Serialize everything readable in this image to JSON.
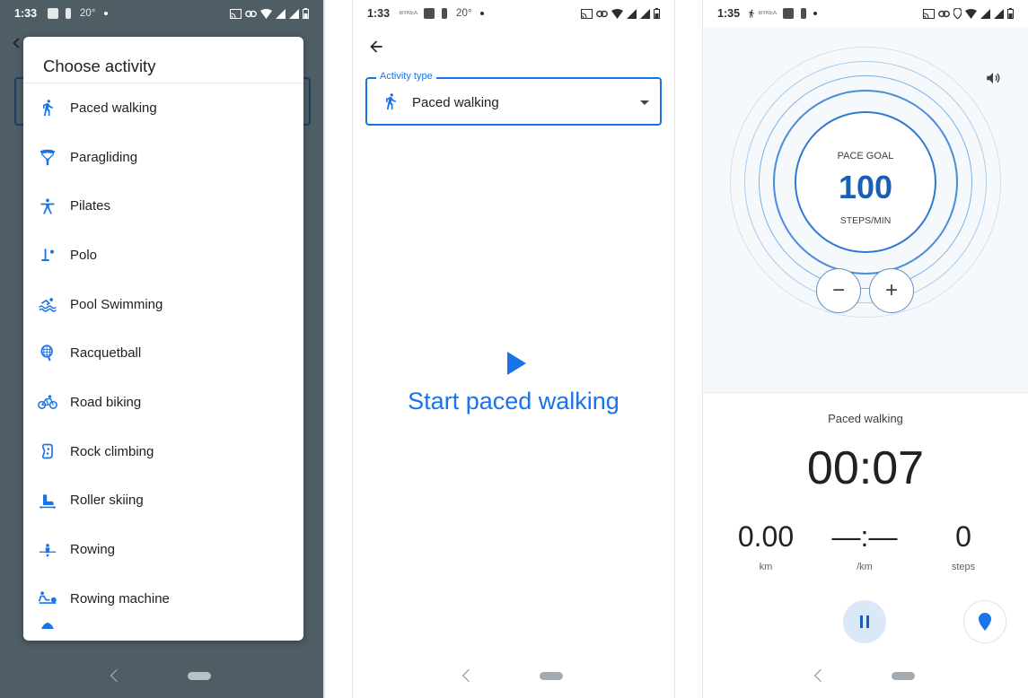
{
  "screen1": {
    "status": {
      "time": "1:33",
      "temp": "20°",
      "tiny": "BYKEA"
    },
    "dialog": {
      "title": "Choose activity",
      "items": [
        {
          "label": "Paced walking",
          "icon": "walking-icon"
        },
        {
          "label": "Paragliding",
          "icon": "paragliding-icon"
        },
        {
          "label": "Pilates",
          "icon": "pilates-icon"
        },
        {
          "label": "Polo",
          "icon": "polo-icon"
        },
        {
          "label": "Pool Swimming",
          "icon": "swimming-icon"
        },
        {
          "label": "Racquetball",
          "icon": "racquet-icon"
        },
        {
          "label": "Road biking",
          "icon": "bike-icon"
        },
        {
          "label": "Rock climbing",
          "icon": "climbing-icon"
        },
        {
          "label": "Roller skiing",
          "icon": "skate-icon"
        },
        {
          "label": "Rowing",
          "icon": "rowing-icon"
        },
        {
          "label": "Rowing machine",
          "icon": "rowing-machine-icon"
        }
      ]
    }
  },
  "screen2": {
    "status": {
      "time": "1:33",
      "temp": "20°",
      "tiny": "BYKEA"
    },
    "activity_type_label": "Activity type",
    "activity_type_value": "Paced walking",
    "start_label": "Start paced walking"
  },
  "screen3": {
    "status": {
      "time": "1:35",
      "tiny": "BYKEA"
    },
    "pace_goal_label": "PACE GOAL",
    "pace_goal_value": "100",
    "pace_goal_unit": "STEPS/MIN",
    "decrease_label": "−",
    "increase_label": "+",
    "activity_name": "Paced walking",
    "timer": "00:07",
    "stats": [
      {
        "value": "0.00",
        "unit": "km"
      },
      {
        "value": "—:—",
        "unit": "/km"
      },
      {
        "value": "0",
        "unit": "steps"
      }
    ]
  },
  "colors": {
    "accent": "#1a73e8",
    "dialog_scrim": "#4f5d65",
    "goal_text": "#1a5fb4"
  }
}
